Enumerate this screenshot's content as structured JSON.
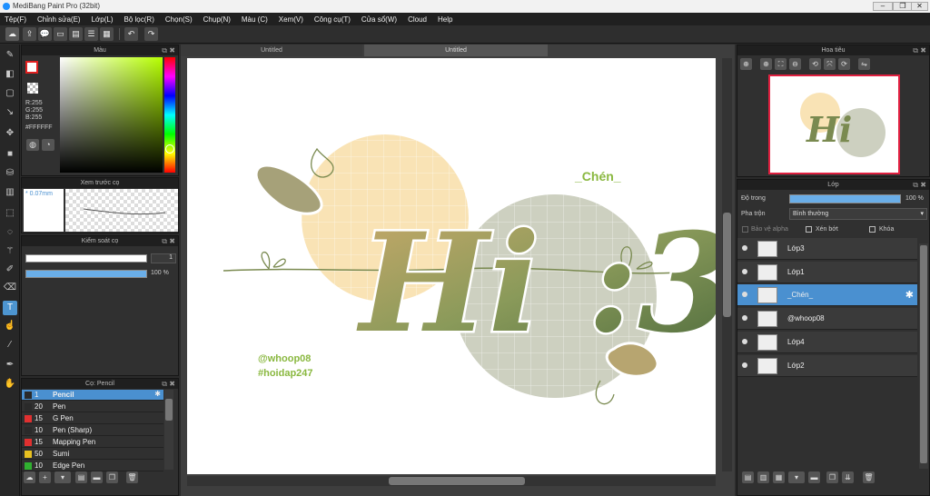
{
  "app": {
    "title": "MediBang Paint Pro (32bit)"
  },
  "menu": [
    "Tệp(F)",
    "Chỉnh sửa(E)",
    "Lớp(L)",
    "Bộ lọc(R)",
    "Chọn(S)",
    "Chụp(N)",
    "Màu (C)",
    "Xem(V)",
    "Công cụ(T)",
    "Cửa sổ(W)",
    "Cloud",
    "Help"
  ],
  "color_panel": {
    "title": "Màu",
    "r": "R:255",
    "g": "G:255",
    "b": "B:255",
    "hex": "#FFFFFF"
  },
  "brush_preview": {
    "title": "Xem trước cọ",
    "size": "* 0.07mm"
  },
  "brush_control": {
    "title": "Kiểm soát cọ",
    "size_value": "1",
    "opacity_value": "100 %"
  },
  "brush_list": {
    "title": "Cọ: Pencil",
    "items": [
      {
        "size": "1",
        "name": "Pencil",
        "color": "#2a2a2a"
      },
      {
        "size": "20",
        "name": "Pen",
        "color": "#2a2a2a"
      },
      {
        "size": "15",
        "name": "G Pen",
        "color": "#e03030"
      },
      {
        "size": "10",
        "name": "Pen (Sharp)",
        "color": "#2a2a2a"
      },
      {
        "size": "15",
        "name": "Mapping Pen",
        "color": "#e03030"
      },
      {
        "size": "50",
        "name": "Sumi",
        "color": "#e8c020"
      },
      {
        "size": "10",
        "name": "Edge Pen",
        "color": "#30b030"
      }
    ]
  },
  "tabs": [
    "Untitled",
    "Untitled"
  ],
  "artwork": {
    "title_text": "Hi :3",
    "name_tag": "_Chén_",
    "handle": "@whoop08",
    "hashtag": "#hoidap247"
  },
  "navigator": {
    "title": "Hoa tiêu"
  },
  "layers_panel": {
    "title": "Lớp",
    "opacity_label": "Độ trong",
    "opacity_value": "100 %",
    "blend_label": "Pha trộn",
    "blend_value": "Bình thường",
    "protect_alpha": "Bảo vệ alpha",
    "clipping": "Xén bớt",
    "lock": "Khóa",
    "layers": [
      {
        "name": "Lớp3"
      },
      {
        "name": "Lớp1"
      },
      {
        "name": "_Chén_"
      },
      {
        "name": "@whoop08"
      },
      {
        "name": "Lớp4"
      },
      {
        "name": "Lớp2"
      }
    ]
  }
}
